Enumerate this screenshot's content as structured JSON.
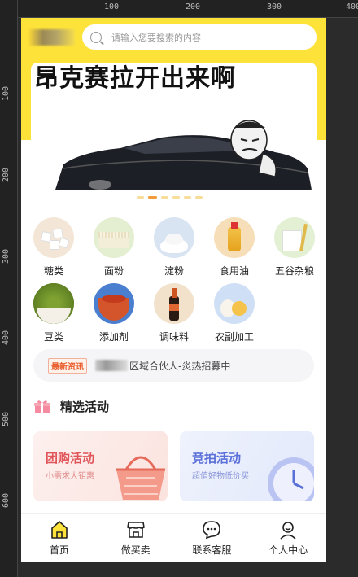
{
  "ruler": {
    "top_marks": [
      "100",
      "200",
      "300",
      "400"
    ],
    "left_marks": [
      "100",
      "200",
      "300",
      "400",
      "500",
      "600"
    ]
  },
  "search": {
    "placeholder": "请输入您要搜索的内容"
  },
  "banner": {
    "text": "昂克赛拉开出来啊"
  },
  "categories": [
    {
      "label": "糖类",
      "icon": "sugar-icon"
    },
    {
      "label": "面粉",
      "icon": "flour-noodle-icon"
    },
    {
      "label": "淀粉",
      "icon": "starch-icon"
    },
    {
      "label": "食用油",
      "icon": "cooking-oil-icon"
    },
    {
      "label": "五谷杂粮",
      "icon": "grain-icon"
    },
    {
      "label": "豆类",
      "icon": "bean-icon"
    },
    {
      "label": "添加剂",
      "icon": "additive-icon"
    },
    {
      "label": "调味料",
      "icon": "seasoning-icon"
    },
    {
      "label": "农副加工",
      "icon": "egg-produce-icon"
    }
  ],
  "news": {
    "tag": "最新资讯",
    "text": "区域合伙人-炎热招募中"
  },
  "section": {
    "title": "精选活动"
  },
  "cards": [
    {
      "title": "团购活动",
      "subtitle": "小需求大钜惠",
      "color": "#e0545a"
    },
    {
      "title": "竞拍活动",
      "subtitle": "超值好物低价买",
      "color": "#5a6fd8"
    }
  ],
  "tabs": [
    {
      "label": "首页",
      "icon": "home-icon"
    },
    {
      "label": "做买卖",
      "icon": "store-icon"
    },
    {
      "label": "联系客服",
      "icon": "chat-icon"
    },
    {
      "label": "个人中心",
      "icon": "user-icon"
    }
  ],
  "colors": {
    "accent": "#fde23a",
    "dot_active": "#f39a3a"
  }
}
